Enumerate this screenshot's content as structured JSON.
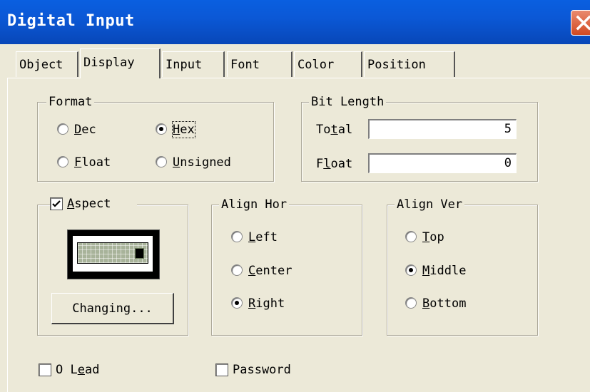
{
  "window": {
    "title": "Digital Input",
    "close_icon": "close-icon",
    "accent": "#0b58d6"
  },
  "tabs": [
    {
      "label": "Object",
      "active": false
    },
    {
      "label": "Display",
      "active": true
    },
    {
      "label": "Input",
      "active": false
    },
    {
      "label": "Font",
      "active": false
    },
    {
      "label": "Color",
      "active": false
    },
    {
      "label": "Position",
      "active": false
    }
  ],
  "format": {
    "legend": "Format",
    "options": [
      {
        "first": "D",
        "rest": "ec",
        "selected": false
      },
      {
        "first": "H",
        "rest": "ex",
        "selected": true
      },
      {
        "first": "F",
        "rest": "loat",
        "selected": false
      },
      {
        "first": "U",
        "rest": "nsigned",
        "selected": false
      }
    ]
  },
  "bit_length": {
    "legend": "Bit Length",
    "total_label_pre": "To",
    "total_label_u": "t",
    "total_label_post": "al",
    "total_value": "5",
    "float_label_pre": "F",
    "float_label_u": "l",
    "float_label_post": "oat",
    "float_value": "0"
  },
  "aspect": {
    "checked": true,
    "label_first": "A",
    "label_rest": "spect",
    "button_label": "Changing..."
  },
  "align_hor": {
    "legend": "Align Hor",
    "options": [
      {
        "first": "L",
        "rest": "eft",
        "selected": false
      },
      {
        "first": "C",
        "rest": "enter",
        "selected": false
      },
      {
        "first": "R",
        "rest": "ight",
        "selected": true
      }
    ]
  },
  "align_ver": {
    "legend": "Align Ver",
    "options": [
      {
        "first": "T",
        "rest": "op",
        "selected": false
      },
      {
        "first": "M",
        "rest": "iddle",
        "selected": true
      },
      {
        "first": "B",
        "rest": "ottom",
        "selected": false
      }
    ]
  },
  "bottom": {
    "o_lead_pre": "O L",
    "o_lead_u": "e",
    "o_lead_post": "ad",
    "o_lead_checked": false,
    "password": "Password",
    "password_checked": false
  }
}
